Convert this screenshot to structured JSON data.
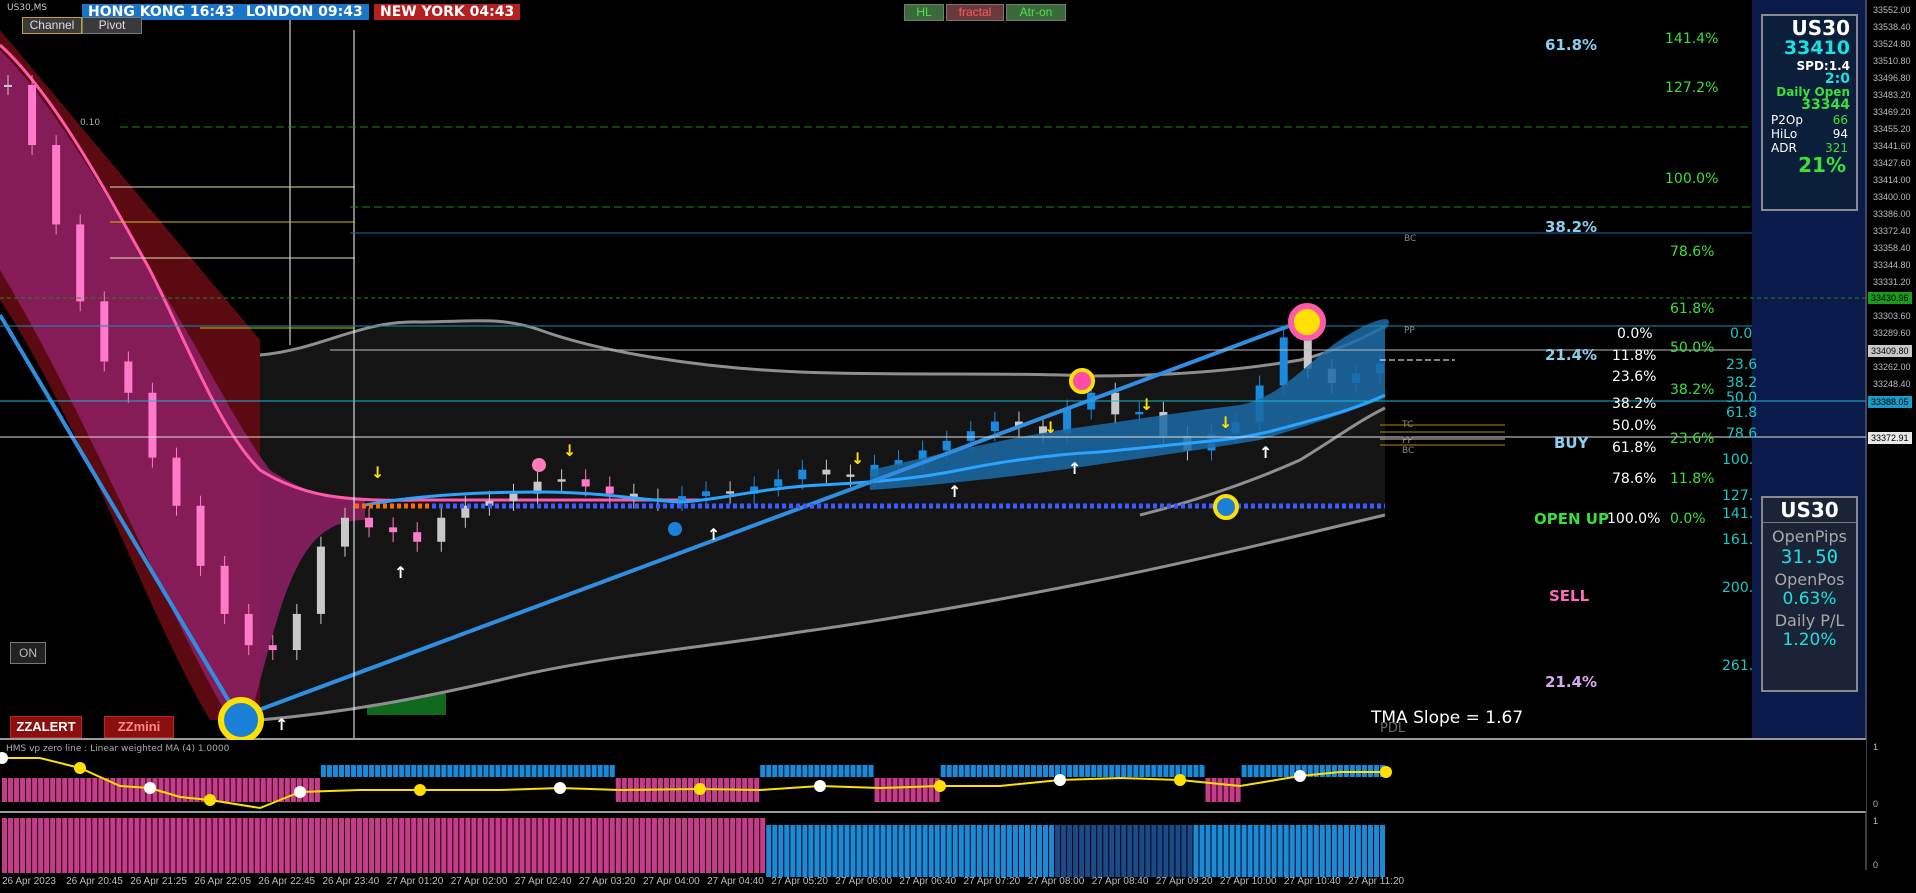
{
  "symbol_label": "US30,MS",
  "sessions": [
    {
      "label": "HONG KONG 16:43",
      "color": "#1a75c8"
    },
    {
      "label": "LONDON  09:43",
      "color": "#1a75c8"
    },
    {
      "label": "NEW YORK  04:43",
      "color": "#b42020"
    }
  ],
  "buttons": {
    "channel": "Channel",
    "pivot": "Pivot",
    "hl": "HL",
    "fractal": "fractal",
    "atr": "Atr-on",
    "on": "ON",
    "zzalert": "ZZALERT",
    "zzmini": "ZZmini"
  },
  "level_010": "0.10",
  "panel_top": {
    "symbol": "US30",
    "price": "33410",
    "spd": "SPD:1.4",
    "ratio": "2:0",
    "daily_open_label": "Daily Open",
    "daily_open": "33344",
    "rows": [
      {
        "k": "P2Op",
        "v": "66"
      },
      {
        "k": "HiLo",
        "v": "94"
      },
      {
        "k": "ADR",
        "v": "321"
      }
    ],
    "pct": "21%"
  },
  "panel_bottom": {
    "symbol": "US30",
    "open_pips_label": "OpenPips",
    "open_pips": "31.50",
    "open_pos_label": "OpenPos",
    "open_pos": "0.63%",
    "daily_pl_label": "Daily P/L",
    "daily_pl": "1.20%"
  },
  "fib_blue": [
    "61.8%",
    "38.2%",
    "21.4%",
    "21.4%"
  ],
  "fib_green": [
    "141.4%",
    "127.2%",
    "100.0%",
    "78.6%",
    "61.8%",
    "50.0%",
    "38.2%",
    "23.6%",
    "11.8%",
    "0.0%"
  ],
  "fib_white": [
    "0.0%",
    "11.8%",
    "23.6%",
    "38.2%",
    "50.0%",
    "61.8%",
    "78.6%",
    "100.0%"
  ],
  "fib_cyan": [
    "0.0",
    "23.6",
    "38.2",
    "50.0",
    "61.8",
    "78.6",
    "100.",
    "127.",
    "141.",
    "161.",
    "200.",
    "261."
  ],
  "signals": {
    "buy": "BUY",
    "open_up": "OPEN UP",
    "sell": "SELL"
  },
  "pivot_labels": {
    "bc_top": "BC",
    "pp": "PP",
    "tc": "TC",
    "pp2": "PP",
    "bc2": "BC"
  },
  "tma_slope": "TMA Slope = 1.67",
  "pdl": "PDL",
  "sub1_label": "HMS  vp zero line :   Linear weighted MA (4) 1.0000",
  "sub2_label": "",
  "y_axis": [
    "33552.00",
    "33538.40",
    "33524.80",
    "33510.80",
    "33496.80",
    "33483.20",
    "33469.20",
    "33455.20",
    "33441.60",
    "33427.60",
    "33414.00",
    "33400.00",
    "33386.00",
    "33372.40",
    "33358.40",
    "33344.80",
    "33331.20",
    "33317.20",
    "33303.60",
    "33289.60",
    "33276.00",
    "33262.00",
    "33248.40"
  ],
  "y_highlight": [
    {
      "label": "33430.96",
      "bg": "#1a9c1a"
    },
    {
      "label": "33409.80",
      "bg": "#c8c8c8"
    },
    {
      "label": "33388.05",
      "bg": "#1a9cc8"
    },
    {
      "label": "33372.91",
      "bg": "#e8e8e8"
    }
  ],
  "sub_axis": {
    "top": "1",
    "bottom": "0"
  },
  "x_axis": [
    "26 Apr 2023",
    "26 Apr 20:45",
    "26 Apr 21:25",
    "26 Apr 22:05",
    "26 Apr 22:45",
    "26 Apr 23:40",
    "27 Apr 01:20",
    "27 Apr 02:00",
    "27 Apr 02:40",
    "27 Apr 03:20",
    "27 Apr 04:00",
    "27 Apr 04:40",
    "27 Apr 05:20",
    "27 Apr 06:00",
    "27 Apr 06:40",
    "27 Apr 07:20",
    "27 Apr 08:00",
    "27 Apr 08:40",
    "27 Apr 09:20",
    "27 Apr 10:00",
    "27 Apr 10:40",
    "27 Apr 11:20"
  ],
  "chart_data": {
    "type": "candlestick",
    "symbol": "US30,MS",
    "ylim": [
      33248.4,
      33552.0
    ],
    "price_series": [
      33520,
      33495,
      33462,
      33430,
      33405,
      33392,
      33365,
      33345,
      33320,
      33300,
      33287,
      33285,
      33300,
      33328,
      33340,
      33336,
      33334,
      33330,
      33340,
      33345,
      33347,
      33350,
      33355,
      33356,
      33353,
      33350,
      33348,
      33347,
      33349,
      33351,
      33350,
      33353,
      33356,
      33360,
      33358,
      33357,
      33362,
      33364,
      33368,
      33372,
      33376,
      33380,
      33378,
      33375,
      33385,
      33392,
      33383,
      33384,
      33374,
      33368,
      33375,
      33380,
      33395,
      33415,
      33402,
      33396,
      33400,
      33404
    ]
  }
}
